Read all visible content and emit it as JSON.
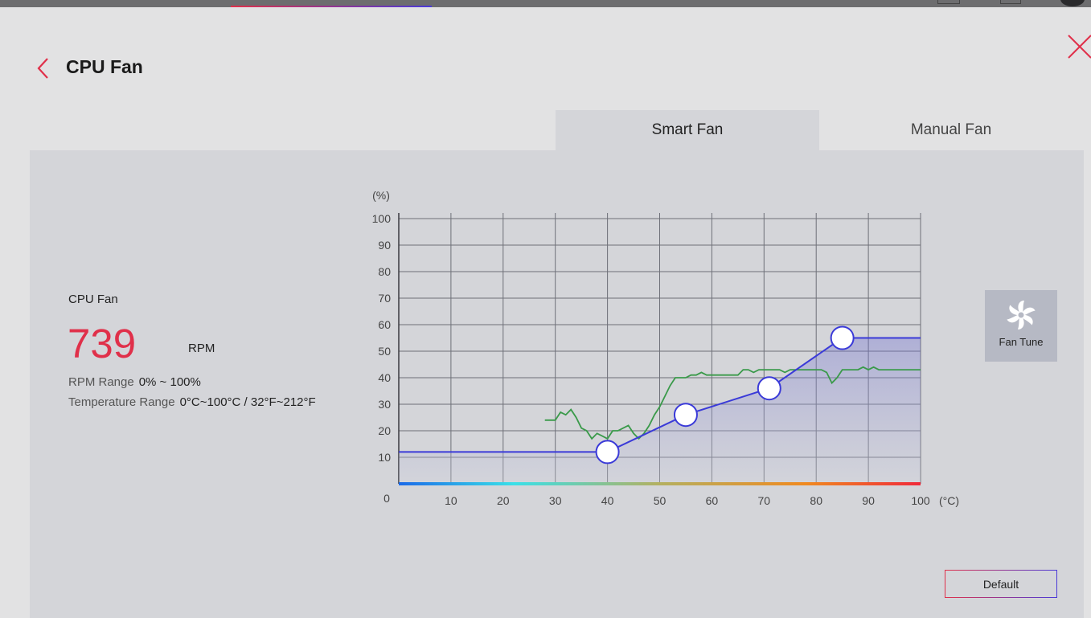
{
  "page": {
    "title": "CPU Fan"
  },
  "tabs": [
    {
      "label": "Smart Fan",
      "active": true
    },
    {
      "label": "Manual Fan",
      "active": false
    }
  ],
  "fan_info": {
    "name": "CPU Fan",
    "rpm": "739",
    "rpm_unit": "RPM",
    "rpm_range_label": "RPM Range",
    "rpm_range_value": "0% ~ 100%",
    "temp_range_label": "Temperature Range",
    "temp_range_value": "0°C~100°C / 32°F~212°F"
  },
  "buttons": {
    "fan_tune": "Fan Tune",
    "default": "Default"
  },
  "colors": {
    "accent_red": "#e0304a",
    "curve_blue": "#3a3ad8",
    "realtime_green": "#3a9a4a"
  },
  "icons": {
    "back": "chevron-left-icon",
    "close": "close-icon",
    "fan_tune": "fan-icon"
  },
  "chart_data": {
    "type": "line",
    "x_unit": "(°C)",
    "y_unit": "(%)",
    "x_ticks": [
      "0",
      "10",
      "20",
      "30",
      "40",
      "50",
      "60",
      "70",
      "80",
      "90",
      "100"
    ],
    "y_ticks": [
      "10",
      "20",
      "30",
      "40",
      "50",
      "60",
      "70",
      "80",
      "90",
      "100"
    ],
    "xlim": [
      0,
      100
    ],
    "ylim": [
      0,
      100
    ],
    "grid": true,
    "fan_curve": {
      "points": [
        [
          0,
          12
        ],
        [
          40,
          12
        ],
        [
          55,
          26
        ],
        [
          71,
          36
        ],
        [
          85,
          55
        ],
        [
          100,
          55
        ]
      ],
      "control_points": [
        [
          40,
          12
        ],
        [
          55,
          26
        ],
        [
          71,
          36
        ],
        [
          85,
          55
        ]
      ]
    },
    "realtime": {
      "points": [
        [
          28,
          24
        ],
        [
          30,
          24
        ],
        [
          31,
          27
        ],
        [
          32,
          26
        ],
        [
          33,
          28
        ],
        [
          34,
          25
        ],
        [
          35,
          21
        ],
        [
          36,
          20
        ],
        [
          37,
          17
        ],
        [
          38,
          19
        ],
        [
          39,
          18
        ],
        [
          40,
          17
        ],
        [
          41,
          20
        ],
        [
          42,
          20
        ],
        [
          43,
          21
        ],
        [
          44,
          22
        ],
        [
          45,
          19
        ],
        [
          46,
          17
        ],
        [
          47,
          19
        ],
        [
          48,
          22
        ],
        [
          49,
          26
        ],
        [
          50,
          29
        ],
        [
          51,
          33
        ],
        [
          52,
          37
        ],
        [
          53,
          40
        ],
        [
          54,
          40
        ],
        [
          55,
          40
        ],
        [
          56,
          41
        ],
        [
          57,
          41
        ],
        [
          58,
          42
        ],
        [
          59,
          41
        ],
        [
          60,
          41
        ],
        [
          61,
          41
        ],
        [
          62,
          41
        ],
        [
          63,
          41
        ],
        [
          64,
          41
        ],
        [
          65,
          41
        ],
        [
          66,
          43
        ],
        [
          67,
          43
        ],
        [
          68,
          42
        ],
        [
          69,
          43
        ],
        [
          70,
          43
        ],
        [
          71,
          43
        ],
        [
          72,
          43
        ],
        [
          73,
          43
        ],
        [
          74,
          42
        ],
        [
          75,
          43
        ],
        [
          76,
          43
        ],
        [
          77,
          43
        ],
        [
          78,
          43
        ],
        [
          79,
          43
        ],
        [
          80,
          43
        ],
        [
          81,
          43
        ],
        [
          82,
          42
        ],
        [
          83,
          38
        ],
        [
          84,
          40
        ],
        [
          85,
          43
        ],
        [
          86,
          43
        ],
        [
          87,
          43
        ],
        [
          88,
          43
        ],
        [
          89,
          44
        ],
        [
          90,
          43
        ],
        [
          91,
          44
        ],
        [
          92,
          43
        ],
        [
          93,
          43
        ],
        [
          94,
          43
        ],
        [
          95,
          43
        ],
        [
          96,
          43
        ],
        [
          97,
          43
        ],
        [
          98,
          43
        ],
        [
          99,
          43
        ],
        [
          100,
          43
        ]
      ]
    }
  }
}
